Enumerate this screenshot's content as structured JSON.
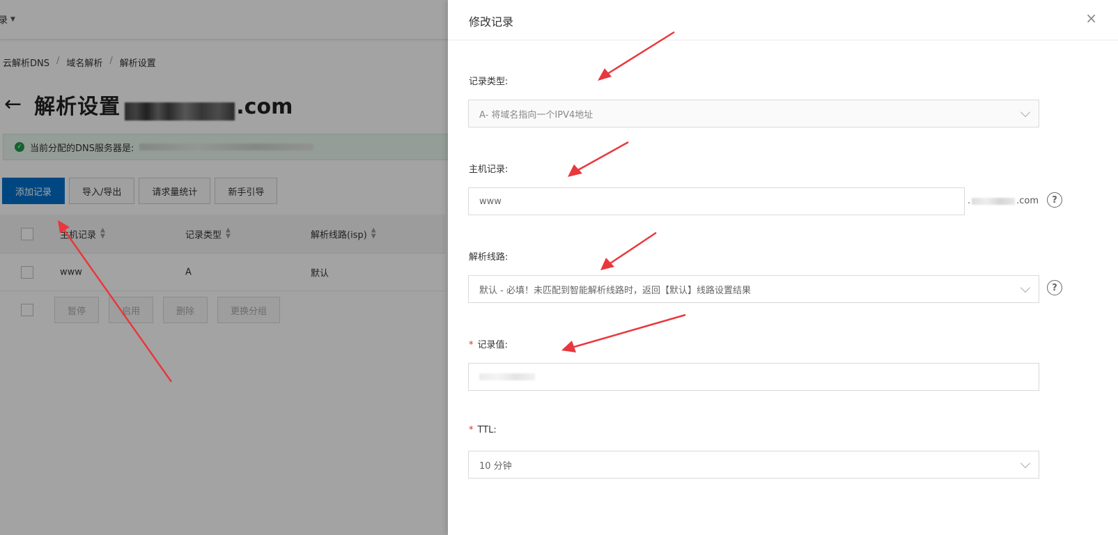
{
  "topbar": {
    "menu_label": "录"
  },
  "breadcrumb": [
    "云解析DNS",
    "域名解析",
    "解析设置"
  ],
  "page": {
    "title": "解析设置",
    "title_suffix": ".com"
  },
  "notice": {
    "text": "当前分配的DNS服务器是:"
  },
  "actions": {
    "add_record": "添加记录",
    "import_export": "导入/导出",
    "request_stats": "请求量统计",
    "guide": "新手引导"
  },
  "table": {
    "headers": {
      "host": "主机记录",
      "type": "记录类型",
      "line": "解析线路(isp)"
    },
    "rows": [
      {
        "host": "www",
        "type": "A",
        "line": "默认"
      }
    ],
    "batch": [
      "暂停",
      "启用",
      "删除",
      "更换分组"
    ]
  },
  "drawer": {
    "title": "修改记录",
    "close": "×",
    "record_type": {
      "label": "记录类型:",
      "value": "A- 将域名指向一个IPV4地址"
    },
    "host": {
      "label": "主机记录:",
      "value": "www",
      "suffix_start": ".",
      "suffix_end": ".com"
    },
    "line": {
      "label": "解析线路:",
      "value": "默认 - 必填！未匹配到智能解析线路时，返回【默认】线路设置结果"
    },
    "value": {
      "required": "*",
      "label": "记录值:"
    },
    "ttl": {
      "required": "*",
      "label": "TTL:",
      "value": "10 分钟"
    },
    "help": "?"
  },
  "colors": {
    "primary": "#0070cc",
    "required": "#d93026",
    "arrow": "#e8383d",
    "success": "#1e9a47"
  }
}
